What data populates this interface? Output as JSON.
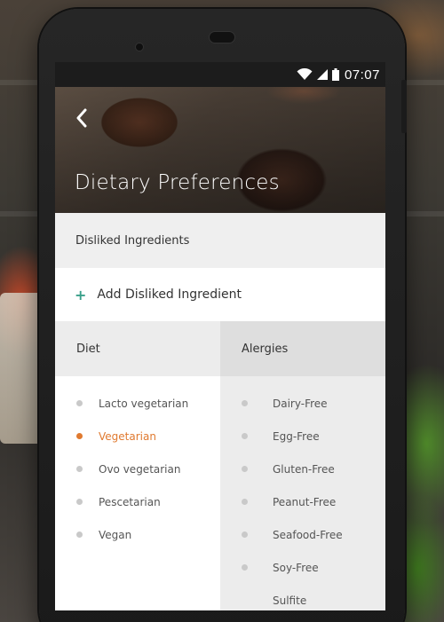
{
  "status_bar": {
    "time": "07:07",
    "wifi_icon": "wifi-icon",
    "signal_icon": "signal-icon",
    "battery_icon": "battery-icon"
  },
  "header": {
    "title": "Dietary Preferences",
    "back_icon": "chevron-left-icon"
  },
  "disliked": {
    "heading": "Disliked Ingredients",
    "add_label": "Add Disliked Ingredient",
    "add_icon": "plus-icon",
    "accent": "#3aa08a"
  },
  "diet": {
    "heading": "Diet",
    "selected_color": "#e07a30",
    "items": [
      {
        "label": "Lacto vegetarian",
        "selected": false
      },
      {
        "label": "Vegetarian",
        "selected": true
      },
      {
        "label": "Ovo vegetarian",
        "selected": false
      },
      {
        "label": "Pescetarian",
        "selected": false
      },
      {
        "label": "Vegan",
        "selected": false
      }
    ]
  },
  "allergies": {
    "heading": "Alergies",
    "items": [
      {
        "label": "Dairy-Free"
      },
      {
        "label": "Egg-Free"
      },
      {
        "label": "Gluten-Free"
      },
      {
        "label": "Peanut-Free"
      },
      {
        "label": "Seafood-Free"
      },
      {
        "label": "Soy-Free"
      },
      {
        "label": "Sulfite"
      }
    ]
  }
}
